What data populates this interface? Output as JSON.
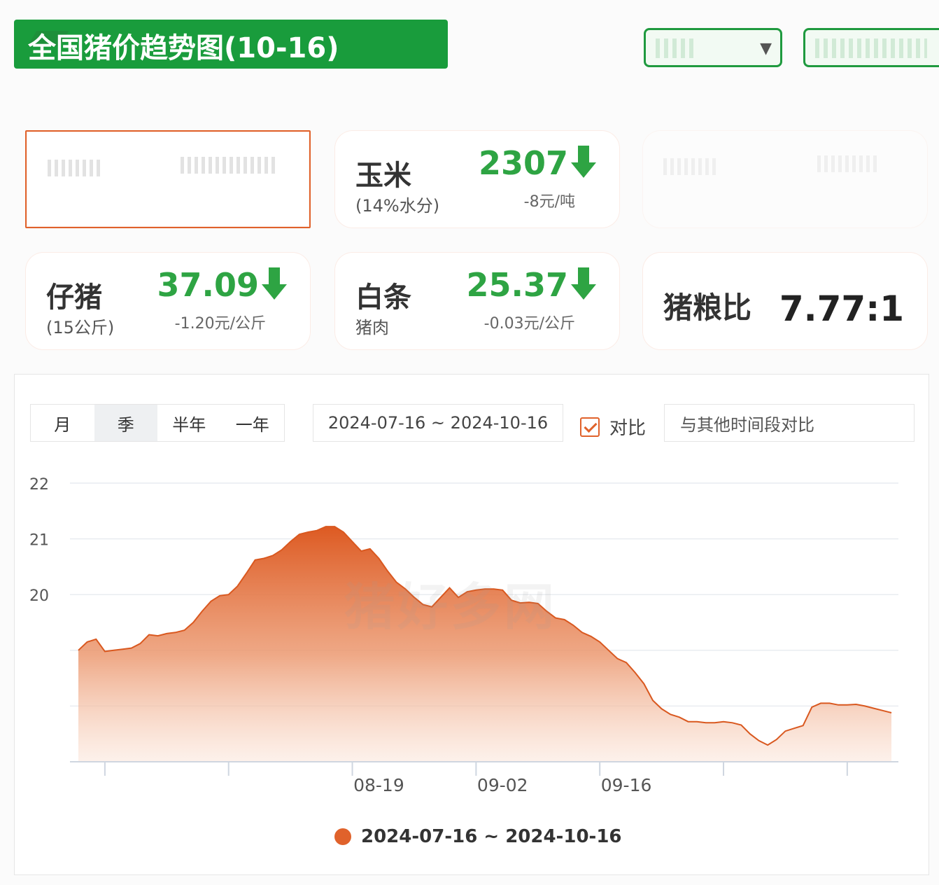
{
  "header": {
    "title": "全国猪价趋势图(10-16)"
  },
  "colors": {
    "brand_green": "#199c3c",
    "down_green": "#2ea443",
    "accent_orange": "#e0622b"
  },
  "cards": {
    "corn": {
      "name": "玉米",
      "sub": "(14%水分)",
      "value": "2307",
      "change": "-8元/吨",
      "trend": "down"
    },
    "piglet": {
      "name": "仔猪",
      "sub": "(15公斤)",
      "value": "37.09",
      "change": "-1.20元/公斤",
      "trend": "down"
    },
    "carcass": {
      "name": "白条",
      "sub": "猪肉",
      "value": "25.37",
      "change": "-0.03元/公斤",
      "trend": "down"
    },
    "ratio": {
      "name": "猪粮比",
      "value": "7.77:1"
    }
  },
  "controls": {
    "tabs": [
      "月",
      "季",
      "半年",
      "一年"
    ],
    "active_tab": "季",
    "date_range": "2024-07-16 ~ 2024-10-16",
    "compare_label": "对比",
    "compare_placeholder": "与其他时间段对比"
  },
  "chart_data": {
    "type": "area",
    "title": "",
    "xlabel": "",
    "ylabel": "",
    "ylim": [
      17,
      22
    ],
    "y_ticks_labeled": [
      20,
      21,
      22
    ],
    "grid": true,
    "x_tick_labels": [
      "08-19",
      "09-02",
      "09-16"
    ],
    "legend_position": "bottom",
    "series": [
      {
        "name": "2024-07-16 ~ 2024-10-16",
        "color": "#e0622b",
        "x": [
          "07-16",
          "07-17",
          "07-18",
          "07-19",
          "07-20",
          "07-21",
          "07-22",
          "07-23",
          "07-24",
          "07-25",
          "07-26",
          "07-27",
          "07-28",
          "07-29",
          "07-30",
          "07-31",
          "08-01",
          "08-02",
          "08-03",
          "08-04",
          "08-05",
          "08-06",
          "08-07",
          "08-08",
          "08-09",
          "08-10",
          "08-11",
          "08-12",
          "08-13",
          "08-14",
          "08-15",
          "08-16",
          "08-17",
          "08-18",
          "08-19",
          "08-20",
          "08-21",
          "08-22",
          "08-23",
          "08-24",
          "08-25",
          "08-26",
          "08-27",
          "08-28",
          "08-29",
          "08-30",
          "08-31",
          "09-01",
          "09-02",
          "09-03",
          "09-04",
          "09-05",
          "09-06",
          "09-07",
          "09-08",
          "09-09",
          "09-10",
          "09-11",
          "09-12",
          "09-13",
          "09-14",
          "09-15",
          "09-16",
          "09-17",
          "09-18",
          "09-19",
          "09-20",
          "09-21",
          "09-22",
          "09-23",
          "09-24",
          "09-25",
          "09-26",
          "09-27",
          "09-28",
          "09-29",
          "09-30",
          "10-01",
          "10-02",
          "10-03",
          "10-04",
          "10-05",
          "10-06",
          "10-07",
          "10-08",
          "10-09",
          "10-10",
          "10-11",
          "10-12",
          "10-13",
          "10-14",
          "10-15",
          "10-16"
        ],
        "values": [
          19.0,
          19.15,
          19.2,
          18.98,
          19.0,
          19.02,
          19.04,
          19.12,
          19.28,
          19.26,
          19.3,
          19.32,
          19.36,
          19.5,
          19.7,
          19.88,
          19.98,
          20.0,
          20.15,
          20.38,
          20.62,
          20.65,
          20.7,
          20.8,
          20.95,
          21.08,
          21.12,
          21.15,
          21.22,
          21.22,
          21.12,
          20.95,
          20.78,
          20.82,
          20.65,
          20.42,
          20.22,
          20.1,
          19.95,
          19.82,
          19.78,
          19.95,
          20.12,
          19.95,
          20.05,
          20.08,
          20.1,
          20.1,
          20.08,
          19.9,
          19.85,
          19.86,
          19.84,
          19.7,
          19.58,
          19.55,
          19.45,
          19.32,
          19.25,
          19.15,
          19.0,
          18.85,
          18.78,
          18.6,
          18.4,
          18.1,
          17.95,
          17.85,
          17.8,
          17.72,
          17.72,
          17.7,
          17.7,
          17.72,
          17.7,
          17.66,
          17.5,
          17.38,
          17.3,
          17.4,
          17.55,
          17.6,
          17.65,
          17.98,
          18.05,
          18.05,
          18.02,
          18.02,
          18.03,
          18.0,
          17.96,
          17.92,
          17.88
        ]
      }
    ]
  }
}
